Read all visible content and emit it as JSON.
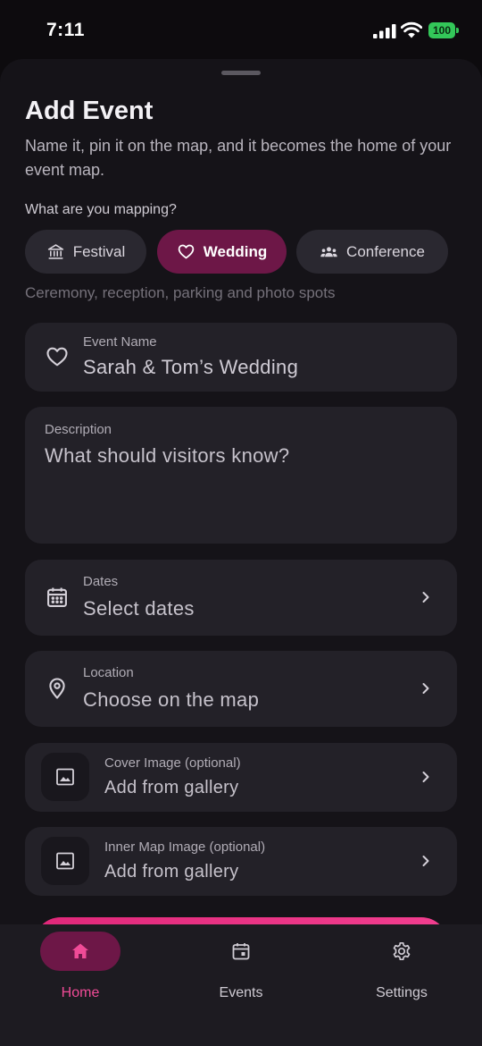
{
  "status_bar": {
    "time": "7:11",
    "battery_level": "100",
    "battery_color": "#33C759"
  },
  "sheet": {
    "title": "Add Event",
    "subtitle": "Name it, pin it on the map, and it becomes the home of your event map.",
    "type_prompt": "What are you mapping?",
    "event_types": [
      {
        "label": "Festival",
        "icon": "building-columns-icon",
        "selected": false
      },
      {
        "label": "Wedding",
        "icon": "heart-icon",
        "selected": true
      },
      {
        "label": "Conference",
        "icon": "people-icon",
        "selected": false
      }
    ],
    "type_hint": "Ceremony, reception, parking and photo spots"
  },
  "form": {
    "event_name": {
      "label": "Event Name",
      "value": "Sarah & Tom’s Wedding",
      "icon": "heart-icon"
    },
    "description": {
      "label": "Description",
      "placeholder": "What should visitors know?"
    },
    "dates": {
      "label": "Dates",
      "value": "Select dates",
      "icon": "calendar-icon"
    },
    "location": {
      "label": "Location",
      "value": "Choose on the map",
      "icon": "map-pin-icon"
    },
    "cover_image": {
      "label": "Cover Image (optional)",
      "value": "Add from gallery",
      "icon": "image-icon"
    },
    "inner_map_image": {
      "label": "Inner Map Image (optional)",
      "value": "Add from gallery",
      "icon": "image-icon"
    }
  },
  "bottom_nav": {
    "items": [
      {
        "label": "Home",
        "icon": "home-icon",
        "active": true
      },
      {
        "label": "Events",
        "icon": "calendar-icon",
        "active": false
      },
      {
        "label": "Settings",
        "icon": "gear-icon",
        "active": false
      }
    ]
  },
  "colors": {
    "accent": "#F04B97",
    "accent_dark": "#6D1747",
    "sheet_background": "#151318",
    "field_background": "#232128"
  }
}
